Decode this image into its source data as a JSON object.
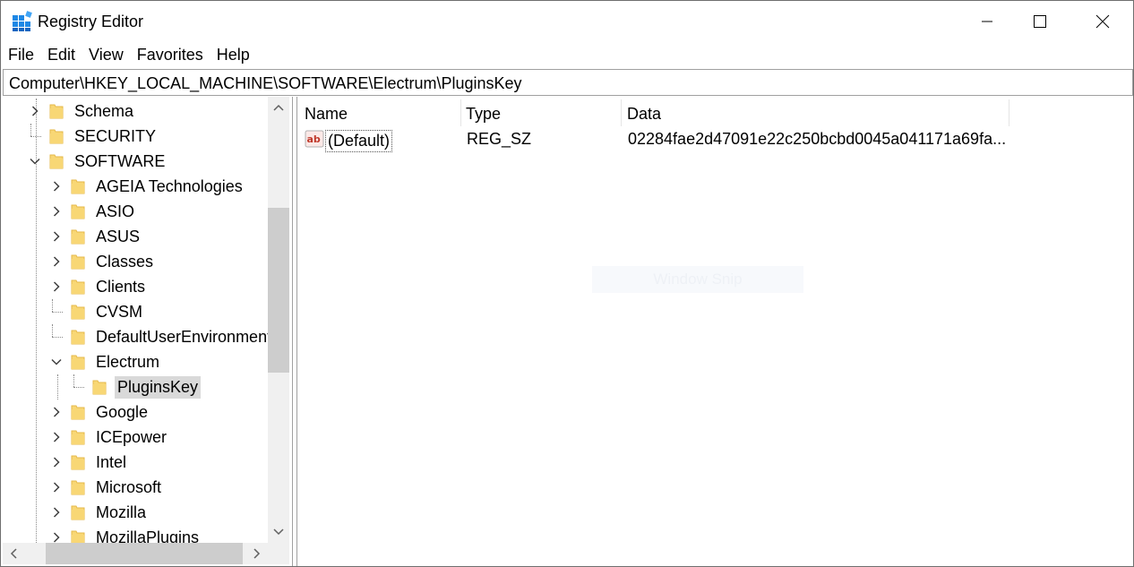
{
  "window": {
    "title": "Registry Editor",
    "icon": "registry-editor-icon"
  },
  "menu": [
    "File",
    "Edit",
    "View",
    "Favorites",
    "Help"
  ],
  "address": "Computer\\HKEY_LOCAL_MACHINE\\SOFTWARE\\Electrum\\PluginsKey",
  "tree": {
    "items": [
      {
        "label": "Schema",
        "level": 0,
        "expander": "collapsed"
      },
      {
        "label": "SECURITY",
        "level": 0,
        "expander": "none"
      },
      {
        "label": "SOFTWARE",
        "level": 0,
        "expander": "expanded"
      },
      {
        "label": "AGEIA Technologies",
        "level": 1,
        "expander": "collapsed"
      },
      {
        "label": "ASIO",
        "level": 1,
        "expander": "collapsed"
      },
      {
        "label": "ASUS",
        "level": 1,
        "expander": "collapsed"
      },
      {
        "label": "Classes",
        "level": 1,
        "expander": "collapsed"
      },
      {
        "label": "Clients",
        "level": 1,
        "expander": "collapsed"
      },
      {
        "label": "CVSM",
        "level": 1,
        "expander": "none"
      },
      {
        "label": "DefaultUserEnvironment",
        "level": 1,
        "expander": "none"
      },
      {
        "label": "Electrum",
        "level": 1,
        "expander": "expanded"
      },
      {
        "label": "PluginsKey",
        "level": 2,
        "expander": "none",
        "selected": true
      },
      {
        "label": "Google",
        "level": 1,
        "expander": "collapsed"
      },
      {
        "label": "ICEpower",
        "level": 1,
        "expander": "collapsed"
      },
      {
        "label": "Intel",
        "level": 1,
        "expander": "collapsed"
      },
      {
        "label": "Microsoft",
        "level": 1,
        "expander": "collapsed"
      },
      {
        "label": "Mozilla",
        "level": 1,
        "expander": "collapsed"
      },
      {
        "label": "MozillaPlugins",
        "level": 1,
        "expander": "collapsed"
      }
    ]
  },
  "values": {
    "columns": [
      "Name",
      "Type",
      "Data"
    ],
    "rows": [
      {
        "name": "(Default)",
        "type": "REG_SZ",
        "data": "02284fae2d47091e22c250bcbd0045a041171a69fa...",
        "icon": "string-value-icon"
      }
    ]
  },
  "overlay": {
    "text": "Window Snip"
  },
  "colors": {
    "folder": "#f8d775",
    "folder_dark": "#e6b94a",
    "selection": "#d9d9d9",
    "reg_icon": "#c0392b"
  }
}
